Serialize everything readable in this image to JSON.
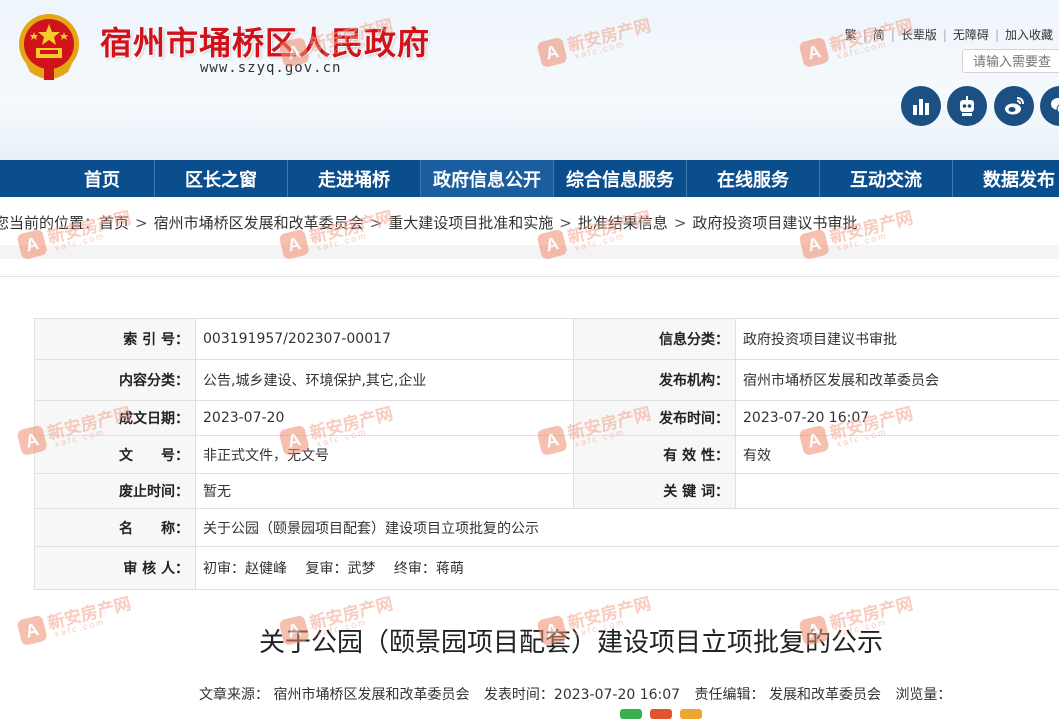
{
  "header": {
    "site_title": "宿州市埇桥区人民政府",
    "site_url": "www.szyq.gov.cn",
    "top_links": [
      "繁",
      "简",
      "长辈版",
      "无障碍",
      "加入收藏"
    ],
    "search_placeholder": "请输入需要查",
    "social_icons": [
      "bar-chart-icon",
      "robot-icon",
      "weibo-icon",
      "wechat-icon"
    ],
    "accent_color": "#d0131a",
    "nav_color": "#0b4e8e"
  },
  "nav": {
    "items": [
      "首页",
      "区长之窗",
      "走进埇桥",
      "政府信息公开",
      "综合信息服务",
      "在线服务",
      "互动交流",
      "数据发布"
    ],
    "active": "政府信息公开"
  },
  "breadcrumb": {
    "prefix": "您当前的位置：",
    "items": [
      "首页",
      "宿州市埇桥区发展和改革委员会",
      "重大建设项目批准和实施",
      "批准结果信息",
      "政府投资项目建议书审批"
    ]
  },
  "info": {
    "index_label": "索 引 号：",
    "index_value": "003191957/202307-00017",
    "category_label": "信息分类：",
    "category_value": "政府投资项目建议书审批",
    "content_label": "内容分类：",
    "content_value": "公告,城乡建设、环境保护,其它,企业",
    "publisher_label": "发布机构：",
    "publisher_value": "宿州市埇桥区发展和改革委员会",
    "created_label": "成文日期：",
    "created_value": "2023-07-20",
    "published_label": "发布时间：",
    "published_value": "2023-07-20 16:07",
    "docno_label": "文　　号：",
    "docno_value": "非正式文件，无文号",
    "validity_label": "有 效 性：",
    "validity_value": "有效",
    "expire_label": "废止时间：",
    "expire_value": "暂无",
    "keywords_label": "关 键 词：",
    "keywords_value": "",
    "name_label": "名　　称：",
    "name_value": "关于公园（颐景园项目配套）建设项目立项批复的公示",
    "reviewer_label": "审 核 人：",
    "reviewer_value": "初审：赵健峰　 复审：武梦　 终审：蒋萌"
  },
  "article": {
    "title": "关于公园（颐景园项目配套）建设项目立项批复的公示",
    "source_label": "文章来源：",
    "source_value": "宿州市埇桥区发展和改革委员会",
    "time_label": "发表时间：",
    "time_value": "2023-07-20 16:07",
    "editor_label": "责任编辑：",
    "editor_value": "发展和改革委员会",
    "views_label": "浏览量："
  },
  "watermark": {
    "logo_letter": "A",
    "text": "新安房产网",
    "sub": "xafc.com"
  }
}
